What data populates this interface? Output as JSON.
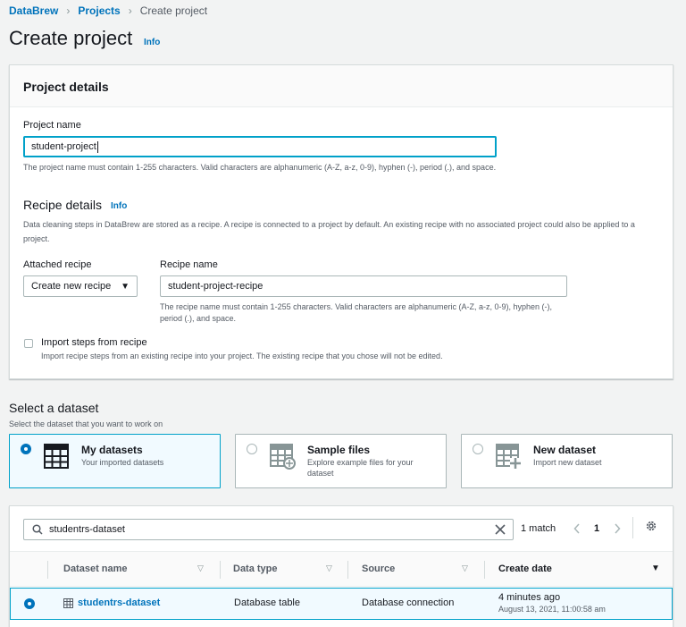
{
  "breadcrumb": {
    "root": "DataBrew",
    "parent": "Projects",
    "current": "Create project"
  },
  "page": {
    "title": "Create project",
    "info": "Info"
  },
  "project_details": {
    "heading": "Project details",
    "name_label": "Project name",
    "name_value": "student-project",
    "name_hint": "The project name must contain 1-255 characters. Valid characters are alphanumeric (A-Z, a-z, 0-9), hyphen (-), period (.), and space."
  },
  "recipe_details": {
    "heading": "Recipe details",
    "info": "Info",
    "description": "Data cleaning steps in DataBrew are stored as a recipe. A recipe is connected to a project by default. An existing recipe with no associated project could also be applied to a project.",
    "attached_label": "Attached recipe",
    "attached_value": "Create new recipe",
    "recipe_name_label": "Recipe name",
    "recipe_name_value": "student-project-recipe",
    "recipe_name_hint": "The recipe name must contain 1-255 characters. Valid characters are alphanumeric (A-Z, a-z, 0-9), hyphen (-), period (.), and space.",
    "import_label": "Import steps from recipe",
    "import_hint": "Import recipe steps from an existing recipe into your project. The existing recipe that you chose will not be edited."
  },
  "dataset_section": {
    "heading": "Select a dataset",
    "subheading": "Select the dataset that you want to work on",
    "options": [
      {
        "title": "My datasets",
        "desc": "Your imported datasets",
        "selected": true
      },
      {
        "title": "Sample files",
        "desc": "Explore example files for your dataset",
        "selected": false
      },
      {
        "title": "New dataset",
        "desc": "Import new dataset",
        "selected": false
      }
    ]
  },
  "table": {
    "search_value": "studentrs-dataset",
    "match_count": "1 match",
    "page": "1",
    "columns": [
      "Dataset name",
      "Data type",
      "Source",
      "Create date"
    ],
    "rows": [
      {
        "name": "studentrs-dataset",
        "type": "Database table",
        "source": "Database connection",
        "created": "4 minutes ago",
        "created_full": "August 13, 2021, 11:00:58 am",
        "selected": true
      }
    ]
  },
  "colors": {
    "link": "#0073bb",
    "focus": "#00a1c9",
    "selected_bg": "#f1faff"
  }
}
